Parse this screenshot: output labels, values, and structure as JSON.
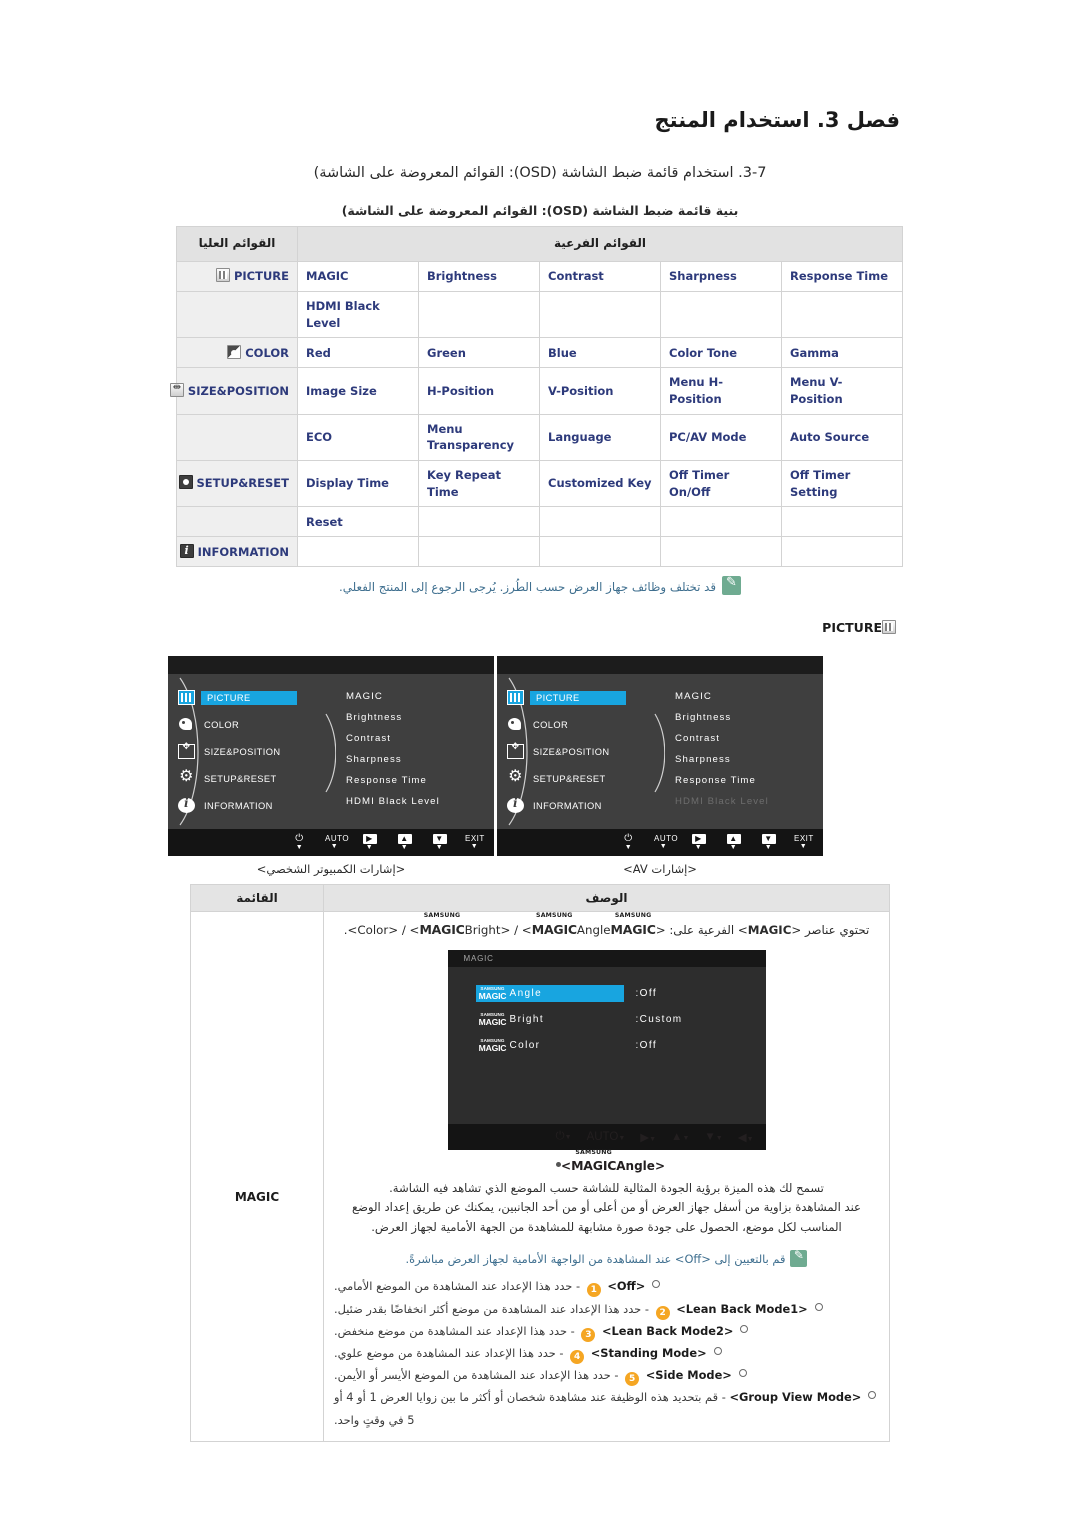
{
  "chapter": {
    "title": "فصل 3. استخدام المنتج",
    "section": "3-7. استخدام قائمة ضبط الشاشة (OSD): القوائم المعروضة على الشاشة)",
    "subsection": "بنية قائمة ضبط الشاشة (OSD): القوائم المعروضة على الشاشة)"
  },
  "menu_table": {
    "header_sub": "القوائم الفرعية",
    "header_top": "القوائم العليا",
    "rows": [
      {
        "top": "PICTURE",
        "top_icon": "picture-icon",
        "subs": [
          "Response Time",
          "Sharpness",
          "Contrast",
          "Brightness",
          "MAGIC"
        ]
      },
      {
        "top": "",
        "top_icon": "",
        "subs": [
          "",
          "",
          "",
          "",
          "HDMI Black Level"
        ]
      },
      {
        "top": "COLOR",
        "top_icon": "color-icon",
        "subs": [
          "Gamma",
          "Color Tone",
          "Blue",
          "Green",
          "Red"
        ]
      },
      {
        "top": "SIZE&POSITION",
        "top_icon": "size-position-icon",
        "subs": [
          "Menu V-Position",
          "Menu H-Position",
          "V-Position",
          "H-Position",
          "Image Size"
        ]
      },
      {
        "top": "",
        "top_icon": "",
        "subs": [
          "Auto Source",
          "PC/AV Mode",
          "Language",
          "Menu Transparency",
          "ECO"
        ]
      },
      {
        "top": "SETUP&RESET",
        "top_icon": "setup-reset-icon",
        "subs": [
          "Off Timer Setting",
          "Off Timer On/Off",
          "Customized Key",
          "Key Repeat Time",
          "Display Time"
        ]
      },
      {
        "top": "",
        "top_icon": "",
        "subs": [
          "",
          "",
          "",
          "",
          "Reset"
        ]
      },
      {
        "top": "INFORMATION",
        "top_icon": "information-icon",
        "subs": [
          "",
          "",
          "",
          "",
          ""
        ]
      }
    ]
  },
  "note": "قد تختلف وظائف جهاز العرض حسب الطُرز. يُرجى الرجوع إلى المنتج الفعلي.",
  "picture_flag": "PICTURE",
  "osd_screens": {
    "left_menu": [
      {
        "label": "PICTURE",
        "icon": "picture-icon",
        "selected": true
      },
      {
        "label": "COLOR",
        "icon": "color-icon",
        "selected": false
      },
      {
        "label": "SIZE&POSITION",
        "icon": "size-position-icon",
        "selected": false
      },
      {
        "label": "SETUP&RESET",
        "icon": "setup-reset-icon",
        "selected": false
      },
      {
        "label": "INFORMATION",
        "icon": "information-icon",
        "selected": false
      }
    ],
    "right_items_pc": [
      {
        "label": "MAGIC",
        "dim": false
      },
      {
        "label": "Brightness",
        "dim": false
      },
      {
        "label": "Contrast",
        "dim": false
      },
      {
        "label": "Sharpness",
        "dim": false
      },
      {
        "label": "Response Time",
        "dim": false
      },
      {
        "label": "HDMI Black Level",
        "dim": false
      }
    ],
    "right_items_av": [
      {
        "label": "MAGIC",
        "dim": false
      },
      {
        "label": "Brightness",
        "dim": false
      },
      {
        "label": "Contrast",
        "dim": false
      },
      {
        "label": "Sharpness",
        "dim": false
      },
      {
        "label": "Response Time",
        "dim": false
      },
      {
        "label": "HDMI Black Level",
        "dim": true
      }
    ],
    "buttons": [
      {
        "name": "power-button",
        "glyph": "⏻",
        "key": ""
      },
      {
        "name": "auto-button",
        "glyph": "",
        "key": "AUTO"
      },
      {
        "name": "enter-button",
        "glyph": "▶",
        "key": ""
      },
      {
        "name": "up-button",
        "glyph": "▲",
        "key": ""
      },
      {
        "name": "down-button",
        "glyph": "▼",
        "key": ""
      },
      {
        "name": "exit-button",
        "glyph": "",
        "key": "EXIT"
      }
    ],
    "caption_pc": "<إشارات الكمبيوتر الشخصي>",
    "caption_av": "<إشارات AV>"
  },
  "desc_table": {
    "header_desc": "الوصف",
    "header_menu": "القائمة",
    "menu_label": "MAGIC",
    "intro_prefix": "تحتوي عناصر <",
    "intro_suffix": "> الفرعية على:",
    "intro_line": "تحتوي عناصر <MAGIC> الفرعية على: <MAGICColorMAGIC> / <MAGICBright> / <Angle>.",
    "magic_osd": {
      "title": "MAGIC",
      "brand_top": "SAMSUNG",
      "brand_bottom": "MAGIC",
      "rows": [
        {
          "name": "Angle",
          "value": ":Off",
          "selected": true
        },
        {
          "name": "Bright",
          "value": ":Custom",
          "selected": false
        },
        {
          "name": "Color",
          "value": ":Off",
          "selected": false
        }
      ]
    },
    "bullet_title_left": "<Angle",
    "bullet_title_right": ">",
    "paragraphs": [
      "تسمح لك هذه الميزة برؤية الجودة المثالية للشاشة حسب الموضع الذي تشاهد فيه الشاشة.",
      "عند المشاهدة بزاوية من أسفل جهاز العرض أو من أعلى أو من أحد الجانبين، يمكنك عن طريق إعداد الوضع المناسب لكل موضع، الحصول على جودة صورة مشابهة للمشاهدة من الجهة الأمامية لجهاز العرض."
    ],
    "tip": "قم بالتعيين إلى <Off> عند المشاهدة من الواجهة الأمامية لجهاز العرض مباشرةً.",
    "modes": [
      {
        "num": "1",
        "name": "<Off>",
        "desc": "- حدد هذا الإعداد عند المشاهدة من الموضع الأمامي."
      },
      {
        "num": "2",
        "name": "<Lean Back Mode1>",
        "desc": "- حدد هذا الإعداد عند المشاهدة من موضع أكثر انخفاضًا بقدر ضئيل."
      },
      {
        "num": "3",
        "name": "<Lean Back Mode2>",
        "desc": "- حدد هذا الإعداد عند المشاهدة من موضع منخفض."
      },
      {
        "num": "4",
        "name": "<Standing Mode>",
        "desc": "- حدد هذا الإعداد عند المشاهدة من موضع علوي."
      },
      {
        "num": "5",
        "name": "<Side Mode>",
        "desc": "- حدد هذا الإعداد عند المشاهدة من الموضع الأيسر أو الأيمن."
      },
      {
        "num": "",
        "name": "<Group View Mode>",
        "desc": "- قم بتحديد هذه الوظيفة عند مشاهدة شخصان أو أكثر ما بين زوايا العرض 1 أو 4 أو 5 في وقتٍ واحد."
      }
    ]
  },
  "colors": {
    "table_header_bg": "#e2e2e2",
    "menu_text": "#2d3a7b",
    "note_text": "#3f6f8f",
    "osd_highlight": "#18a5e0",
    "badge": "#f5a623"
  }
}
